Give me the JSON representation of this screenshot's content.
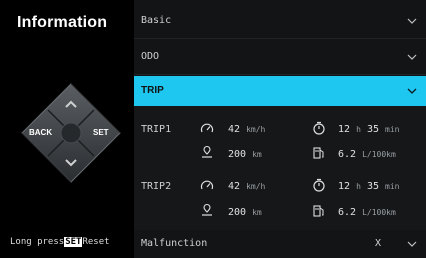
{
  "sidebar": {
    "title": "Information",
    "back_label": "BACK",
    "set_label": "SET",
    "hint_prefix": "Long press",
    "hint_key": "SET",
    "hint_suffix": "Reset"
  },
  "menu": {
    "basic": "Basic",
    "odo": "ODO",
    "trip": "TRIP",
    "malfunction": "Malfunction",
    "malfunction_status": "X"
  },
  "trips": [
    {
      "name": "TRIP1",
      "speed": "42",
      "speed_unit": "km/h",
      "distance": "200",
      "distance_unit": "km",
      "time_h": "12",
      "time_h_unit": "h",
      "time_m": "35",
      "time_m_unit": "min",
      "fuel": "6.2",
      "fuel_unit": "L/100km"
    },
    {
      "name": "TRIP2",
      "speed": "42",
      "speed_unit": "km/h",
      "distance": "200",
      "distance_unit": "km",
      "time_h": "12",
      "time_h_unit": "h",
      "time_m": "35",
      "time_m_unit": "min",
      "fuel": "6.2",
      "fuel_unit": "L/100km"
    }
  ],
  "icons": {
    "speed": "speedometer-icon",
    "distance": "location-pin-icon",
    "time": "stopwatch-icon",
    "fuel": "fuel-pump-icon"
  },
  "colors": {
    "accent": "#1ec7ef",
    "background": "#000000",
    "panel": "#121416"
  }
}
